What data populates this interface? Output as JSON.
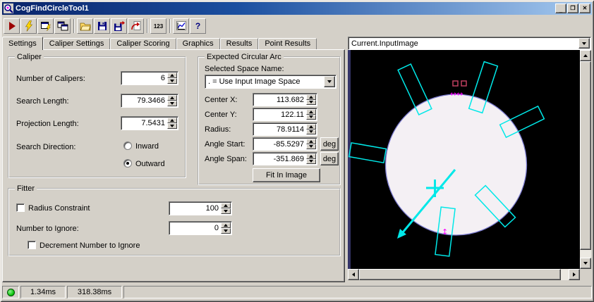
{
  "titlebar": {
    "title": "CogFindCircleTool1",
    "minimize": "_",
    "maximize": "❐",
    "close": "✕"
  },
  "toolbar": {
    "buttons": [
      "run",
      "electric-run",
      "run-subtool",
      "run-tool-window",
      "open-file",
      "save-file",
      "save-image",
      "revert",
      "number-format",
      "results-graph",
      "help"
    ],
    "number_format_label": "123",
    "help_label": "?"
  },
  "tabs": {
    "settings": "Settings",
    "caliper_settings": "Caliper Settings",
    "caliper_scoring": "Caliper Scoring",
    "graphics": "Graphics",
    "results": "Results",
    "point_results": "Point Results"
  },
  "caliper": {
    "group_title": "Caliper",
    "number_label": "Number of Calipers:",
    "number_value": "6",
    "search_length_label": "Search Length:",
    "search_length_value": "79.3466",
    "projection_length_label": "Projection Length:",
    "projection_length_value": "7.5431",
    "search_direction_label": "Search Direction:",
    "inward_label": "Inward",
    "outward_label": "Outward",
    "search_direction_selected": "Outward"
  },
  "arc": {
    "group_title": "Expected Circular Arc",
    "space_label": "Selected Space Name:",
    "space_value": ". = Use Input Image Space",
    "center_x_label": "Center X:",
    "center_x_value": "113.682",
    "center_y_label": "Center Y:",
    "center_y_value": "122.11",
    "radius_label": "Radius:",
    "radius_value": "78.9114",
    "angle_start_label": "Angle Start:",
    "angle_start_value": "-85.5297",
    "angle_span_label": "Angle Span:",
    "angle_span_value": "-351.869",
    "deg_label": "deg",
    "fit_button_label": "Fit In Image"
  },
  "fitter": {
    "group_title": "Fitter",
    "radius_constraint_label": "Radius Constraint",
    "radius_constraint_checked": false,
    "radius_constraint_value": "100",
    "number_ignore_label": "Number to Ignore:",
    "number_ignore_value": "0",
    "decrement_label": "Decrement Number to Ignore",
    "decrement_checked": false
  },
  "image_panel": {
    "selector_value": "Current.InputImage",
    "overlay_colors": {
      "caliper": "#00e8e8",
      "marker": "#ff00ff",
      "circle_fill": "#f4f0f4",
      "circle_edge": "#7a7ace",
      "background": "#000000"
    }
  },
  "statusbar": {
    "time1": "1.34ms",
    "time2": "318.38ms"
  }
}
